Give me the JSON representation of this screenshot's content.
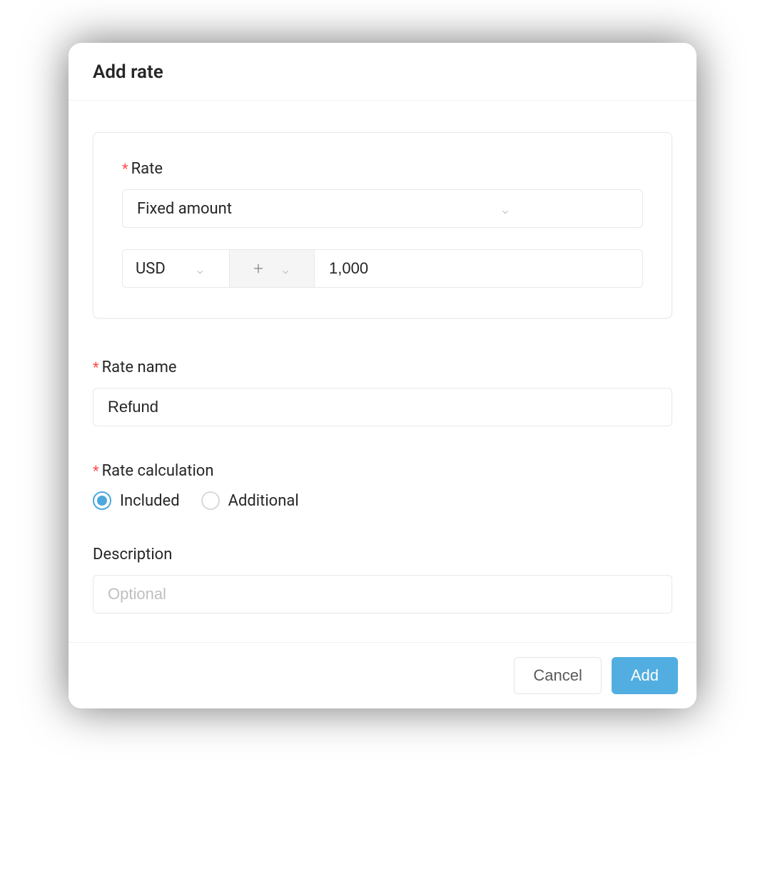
{
  "modal": {
    "title": "Add rate"
  },
  "rate": {
    "label": "Rate",
    "type_value": "Fixed amount",
    "currency": "USD",
    "symbol": "+",
    "amount": "1,000"
  },
  "rate_name": {
    "label": "Rate name",
    "value": "Refund"
  },
  "rate_calc": {
    "label": "Rate calculation",
    "options": {
      "included": "Included",
      "additional": "Additional"
    },
    "selected": "included"
  },
  "description": {
    "label": "Description",
    "placeholder": "Optional",
    "value": ""
  },
  "footer": {
    "cancel": "Cancel",
    "add": "Add"
  }
}
